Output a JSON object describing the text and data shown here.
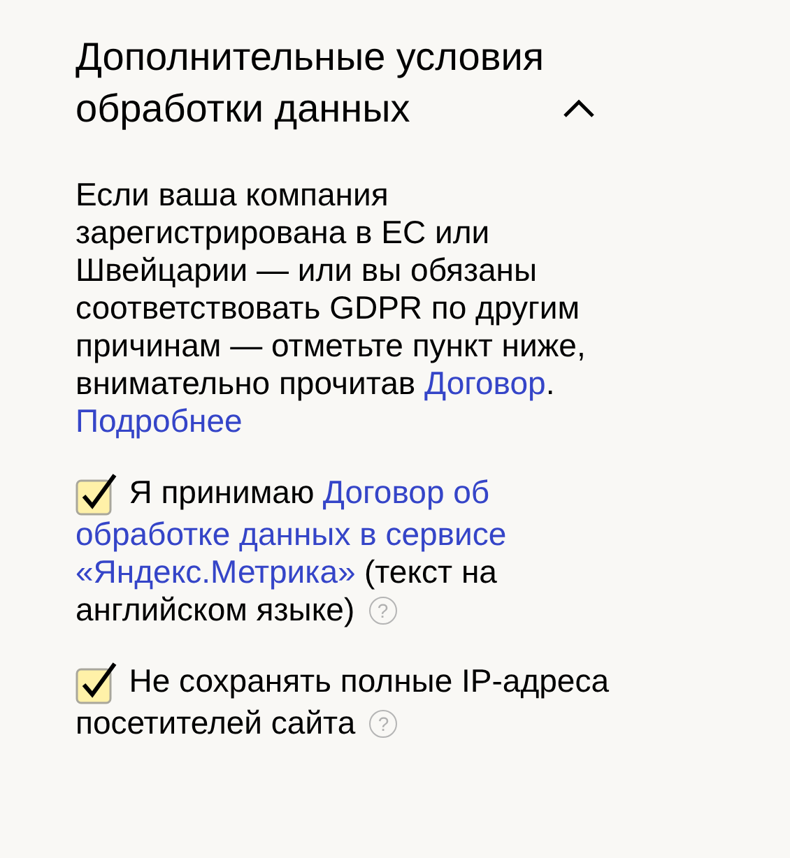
{
  "section": {
    "title": "Дополнительные условия обработки данных",
    "expanded": true
  },
  "description": {
    "text": "Если ваша компания зарегистрирована в ЕС или Швейцарии — или вы обязаны соответствовать GDPR по другим причинам — отметьте пункт ниже, внимательно прочитав ",
    "link": "Договор",
    "end": ".",
    "more_link": "Подробнее"
  },
  "options": [
    {
      "checked": true,
      "lines": [
        [
          {
            "kind": "text",
            "text": "Я принимаю"
          },
          {
            "kind": "link",
            "text": "Договор об"
          }
        ],
        [
          {
            "kind": "link",
            "text": "обработке данных в сервисе"
          }
        ],
        [
          {
            "kind": "link",
            "text": "«Яндекс.Метрика»"
          },
          {
            "kind": "text",
            "text": "(текст на"
          }
        ],
        [
          {
            "kind": "text",
            "text": "английском языке)"
          }
        ]
      ],
      "help": "?"
    },
    {
      "checked": true,
      "lines": [
        [
          {
            "kind": "text",
            "text": "Не сохранять полные IP-адреса"
          }
        ],
        [
          {
            "kind": "text",
            "text": "посетителей сайта"
          }
        ]
      ],
      "help": "?"
    }
  ]
}
